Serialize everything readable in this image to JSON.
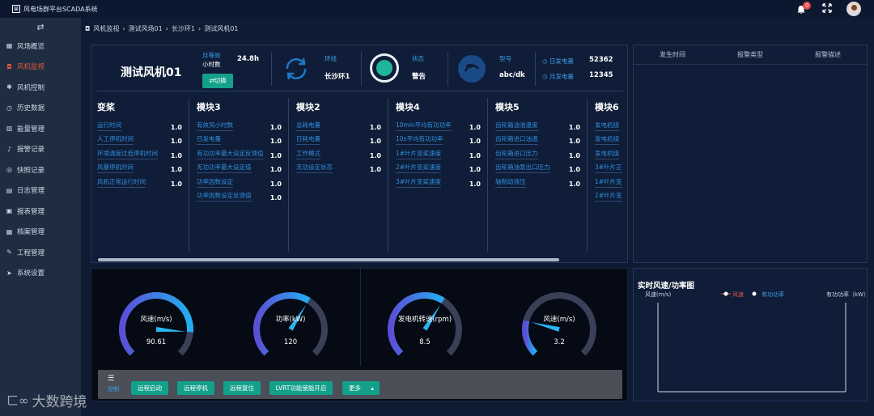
{
  "app": {
    "title": "风电场群平台SCADA系统",
    "notification_count": "0"
  },
  "sidebar": {
    "items": [
      {
        "label": "风场概览",
        "icon": "grid-icon",
        "glyph": "▦"
      },
      {
        "label": "风机监视",
        "icon": "camera-icon",
        "glyph": "◘",
        "active": true
      },
      {
        "label": "风机控制",
        "icon": "gear-icon",
        "glyph": "✱"
      },
      {
        "label": "历史数据",
        "icon": "clock-icon",
        "glyph": "◷"
      },
      {
        "label": "能量管理",
        "icon": "chart-icon",
        "glyph": "▥"
      },
      {
        "label": "报警记录",
        "icon": "bell-icon",
        "glyph": "♪"
      },
      {
        "label": "快照记录",
        "icon": "snapshot-icon",
        "glyph": "◎"
      },
      {
        "label": "日志管理",
        "icon": "book-icon",
        "glyph": "▤"
      },
      {
        "label": "报表管理",
        "icon": "report-icon",
        "glyph": "▣"
      },
      {
        "label": "档案管理",
        "icon": "archive-icon",
        "glyph": "▦"
      },
      {
        "label": "工程管理",
        "icon": "wrench-icon",
        "glyph": "✎"
      },
      {
        "label": "系统设置",
        "icon": "settings-icon",
        "glyph": "➤"
      }
    ]
  },
  "breadcrumb": [
    "风机监视",
    "测试风场01",
    "长沙环1",
    "测试风机01"
  ],
  "turbine": {
    "name": "测试风机01",
    "monthly_hours_label_1": "月等效",
    "monthly_hours_label_2": "小时数",
    "monthly_hours_value": "24.8h",
    "toggle_label": "⇄切换",
    "ring_label": "环线",
    "ring_value": "长沙环1",
    "status_label": "状态",
    "status_value": "警告",
    "model_label": "型号",
    "model_value": "abc/dk",
    "daily_energy_label": "日发电量",
    "daily_energy_value": "52362",
    "monthly_energy_label": "月发电量",
    "monthly_energy_value": "12345"
  },
  "modules": [
    {
      "title": "变桨",
      "rows": [
        {
          "label": "运行时间",
          "value": "1.0"
        },
        {
          "label": "人工停机时间",
          "value": "1.0"
        },
        {
          "label": "环境温度过低停机时间",
          "value": "1.0"
        },
        {
          "label": "风暴停机时间",
          "value": "1.0"
        },
        {
          "label": "风机正常运行时间",
          "value": "1.0"
        }
      ]
    },
    {
      "title": "模块3",
      "rows": [
        {
          "label": "有效风小时数",
          "value": "1.0"
        },
        {
          "label": "日发电量",
          "value": "1.0"
        },
        {
          "label": "有功功率最大设定反馈值",
          "value": "1.0"
        },
        {
          "label": "无功功率最大设定值",
          "value": "1.0"
        },
        {
          "label": "功率因数设定",
          "value": "1.0"
        },
        {
          "label": "功率因数设定反馈值",
          "value": "1.0"
        }
      ]
    },
    {
      "title": "模块2",
      "rows": [
        {
          "label": "总耗电量",
          "value": "1.0"
        },
        {
          "label": "日耗电量",
          "value": "1.0"
        },
        {
          "label": "工作模式",
          "value": "1.0"
        },
        {
          "label": "无功设定状态",
          "value": "1.0"
        }
      ]
    },
    {
      "title": "模块4",
      "rows": [
        {
          "label": "10min平均有功功率",
          "value": "1.0"
        },
        {
          "label": "10s平均有功功率",
          "value": "1.0"
        },
        {
          "label": "1#叶片变桨速度",
          "value": "1.0"
        },
        {
          "label": "2#叶片变桨速度",
          "value": "1.0"
        },
        {
          "label": "3#叶片变桨速度",
          "value": "1.0"
        }
      ]
    },
    {
      "title": "模块5",
      "rows": [
        {
          "label": "齿轮箱油池温度",
          "value": "1.0"
        },
        {
          "label": "齿轮箱进口油温",
          "value": "1.0"
        },
        {
          "label": "齿轮箱进口压力",
          "value": "1.0"
        },
        {
          "label": "齿轮箱油泵出口压力",
          "value": "1.0"
        },
        {
          "label": "轴制动液压",
          "value": "1.0"
        }
      ]
    },
    {
      "title": "模块6",
      "rows": [
        {
          "label": "发电机绕",
          "value": ""
        },
        {
          "label": "发电机绕",
          "value": ""
        },
        {
          "label": "发电机绕",
          "value": ""
        },
        {
          "label": "3#叶片正",
          "value": ""
        },
        {
          "label": "1#叶片变",
          "value": ""
        },
        {
          "label": "2#叶片变",
          "value": ""
        }
      ]
    }
  ],
  "alarm_table": {
    "columns": [
      "发生时间",
      "报警类型",
      "报警描述"
    ]
  },
  "gauges": [
    {
      "label": "风速(m/s)",
      "value": "90.61",
      "fraction": 0.85
    },
    {
      "label": "功率(kW)",
      "value": "120",
      "fraction": 0.62
    },
    {
      "label": "发电机转速(rpm)",
      "value": "8.5",
      "fraction": 0.62
    },
    {
      "label": "风速(m/s)",
      "value": "3.2",
      "fraction": 0.22
    }
  ],
  "controls": {
    "label": "控制",
    "buttons": [
      "远程启动",
      "远程停机",
      "远程复位",
      "LVRT功能使能开启"
    ],
    "more": "更多"
  },
  "chart": {
    "title": "实时风速/功率图",
    "left_axis": "风速(m/s)",
    "right_axis": "有功功率（kW）",
    "legend": [
      "风速",
      "有功功率"
    ]
  },
  "watermark": "大数跨境",
  "colors": {
    "accent": "#13a08b",
    "gauge_blue": "#2a8de6",
    "active": "#e05a3a"
  }
}
